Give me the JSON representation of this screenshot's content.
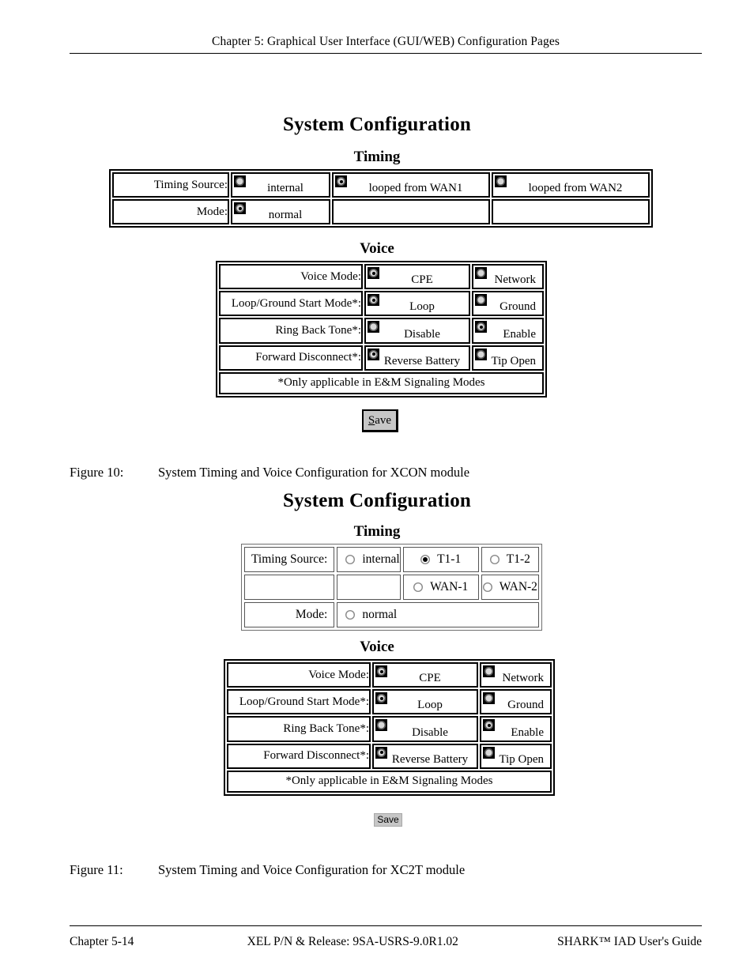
{
  "page": {
    "running_header": "Chapter 5: Graphical User Interface (GUI/WEB) Configuration Pages",
    "footer_left": "Chapter 5-14",
    "footer_center": "XEL P/N & Release: 9SA-USRS-9.0R1.02",
    "footer_right": "SHARK™ IAD User's Guide"
  },
  "figure_10": {
    "caption_label": "Figure 10:",
    "caption_text": "System Timing and Voice Configuration for XCON module",
    "page_title": "System Configuration",
    "timing": {
      "heading": "Timing",
      "rows": [
        {
          "label": "Timing Source:",
          "options": [
            {
              "label": "internal",
              "selected": false
            },
            {
              "label": "looped from WAN1",
              "selected": true
            },
            {
              "label": "looped from WAN2",
              "selected": false
            }
          ]
        },
        {
          "label": "Mode:",
          "options": [
            {
              "label": "normal",
              "selected": true
            },
            {
              "label": "",
              "selected": null
            },
            {
              "label": "",
              "selected": null
            }
          ]
        }
      ]
    },
    "voice": {
      "heading": "Voice",
      "rows": [
        {
          "label": "Voice Mode:",
          "options": [
            {
              "label": "CPE",
              "selected": true
            },
            {
              "label": "Network",
              "selected": false
            }
          ]
        },
        {
          "label": "Loop/Ground Start Mode*:",
          "options": [
            {
              "label": "Loop",
              "selected": true
            },
            {
              "label": "Ground",
              "selected": false
            }
          ]
        },
        {
          "label": "Ring Back Tone*:",
          "options": [
            {
              "label": "Disable",
              "selected": false
            },
            {
              "label": "Enable",
              "selected": true
            }
          ]
        },
        {
          "label": "Forward Disconnect*:",
          "options": [
            {
              "label": "Reverse Battery",
              "selected": true
            },
            {
              "label": "Tip Open",
              "selected": false
            }
          ]
        }
      ],
      "footnote": "*Only applicable in E&M Signaling Modes"
    },
    "save_label": "Save",
    "save_accel": "S",
    "save_rest": "ave"
  },
  "figure_11": {
    "caption_label": "Figure 11:",
    "caption_text": "System Timing and Voice Configuration for XC2T module",
    "page_title": "System Configuration",
    "timing": {
      "heading": "Timing",
      "row1_label": "Timing Source:",
      "row1_options": [
        {
          "label": "internal",
          "selected": false
        },
        {
          "label": "T1-1",
          "selected": true
        },
        {
          "label": "T1-2",
          "selected": false
        }
      ],
      "row2_options": [
        {
          "label": "WAN-1",
          "selected": false
        },
        {
          "label": "WAN-2",
          "selected": false
        }
      ],
      "row3_label": "Mode:",
      "row3_options": [
        {
          "label": "normal",
          "selected": false
        }
      ]
    },
    "voice": {
      "heading": "Voice",
      "rows": [
        {
          "label": "Voice Mode:",
          "options": [
            {
              "label": "CPE",
              "selected": true
            },
            {
              "label": "Network",
              "selected": false
            }
          ]
        },
        {
          "label": "Loop/Ground Start  Mode*:",
          "options": [
            {
              "label": "Loop",
              "selected": true
            },
            {
              "label": "Ground",
              "selected": false
            }
          ]
        },
        {
          "label": "Ring Back  Tone*:",
          "options": [
            {
              "label": "Disable",
              "selected": false
            },
            {
              "label": "Enable",
              "selected": true
            }
          ]
        },
        {
          "label": "Forward  Disconnect*:",
          "options": [
            {
              "label": "Reverse Battery",
              "selected": true
            },
            {
              "label": "Tip Open",
              "selected": false
            }
          ]
        }
      ],
      "footnote": "*Only applicable in E&M Signaling Modes"
    },
    "save_label": "Save"
  }
}
